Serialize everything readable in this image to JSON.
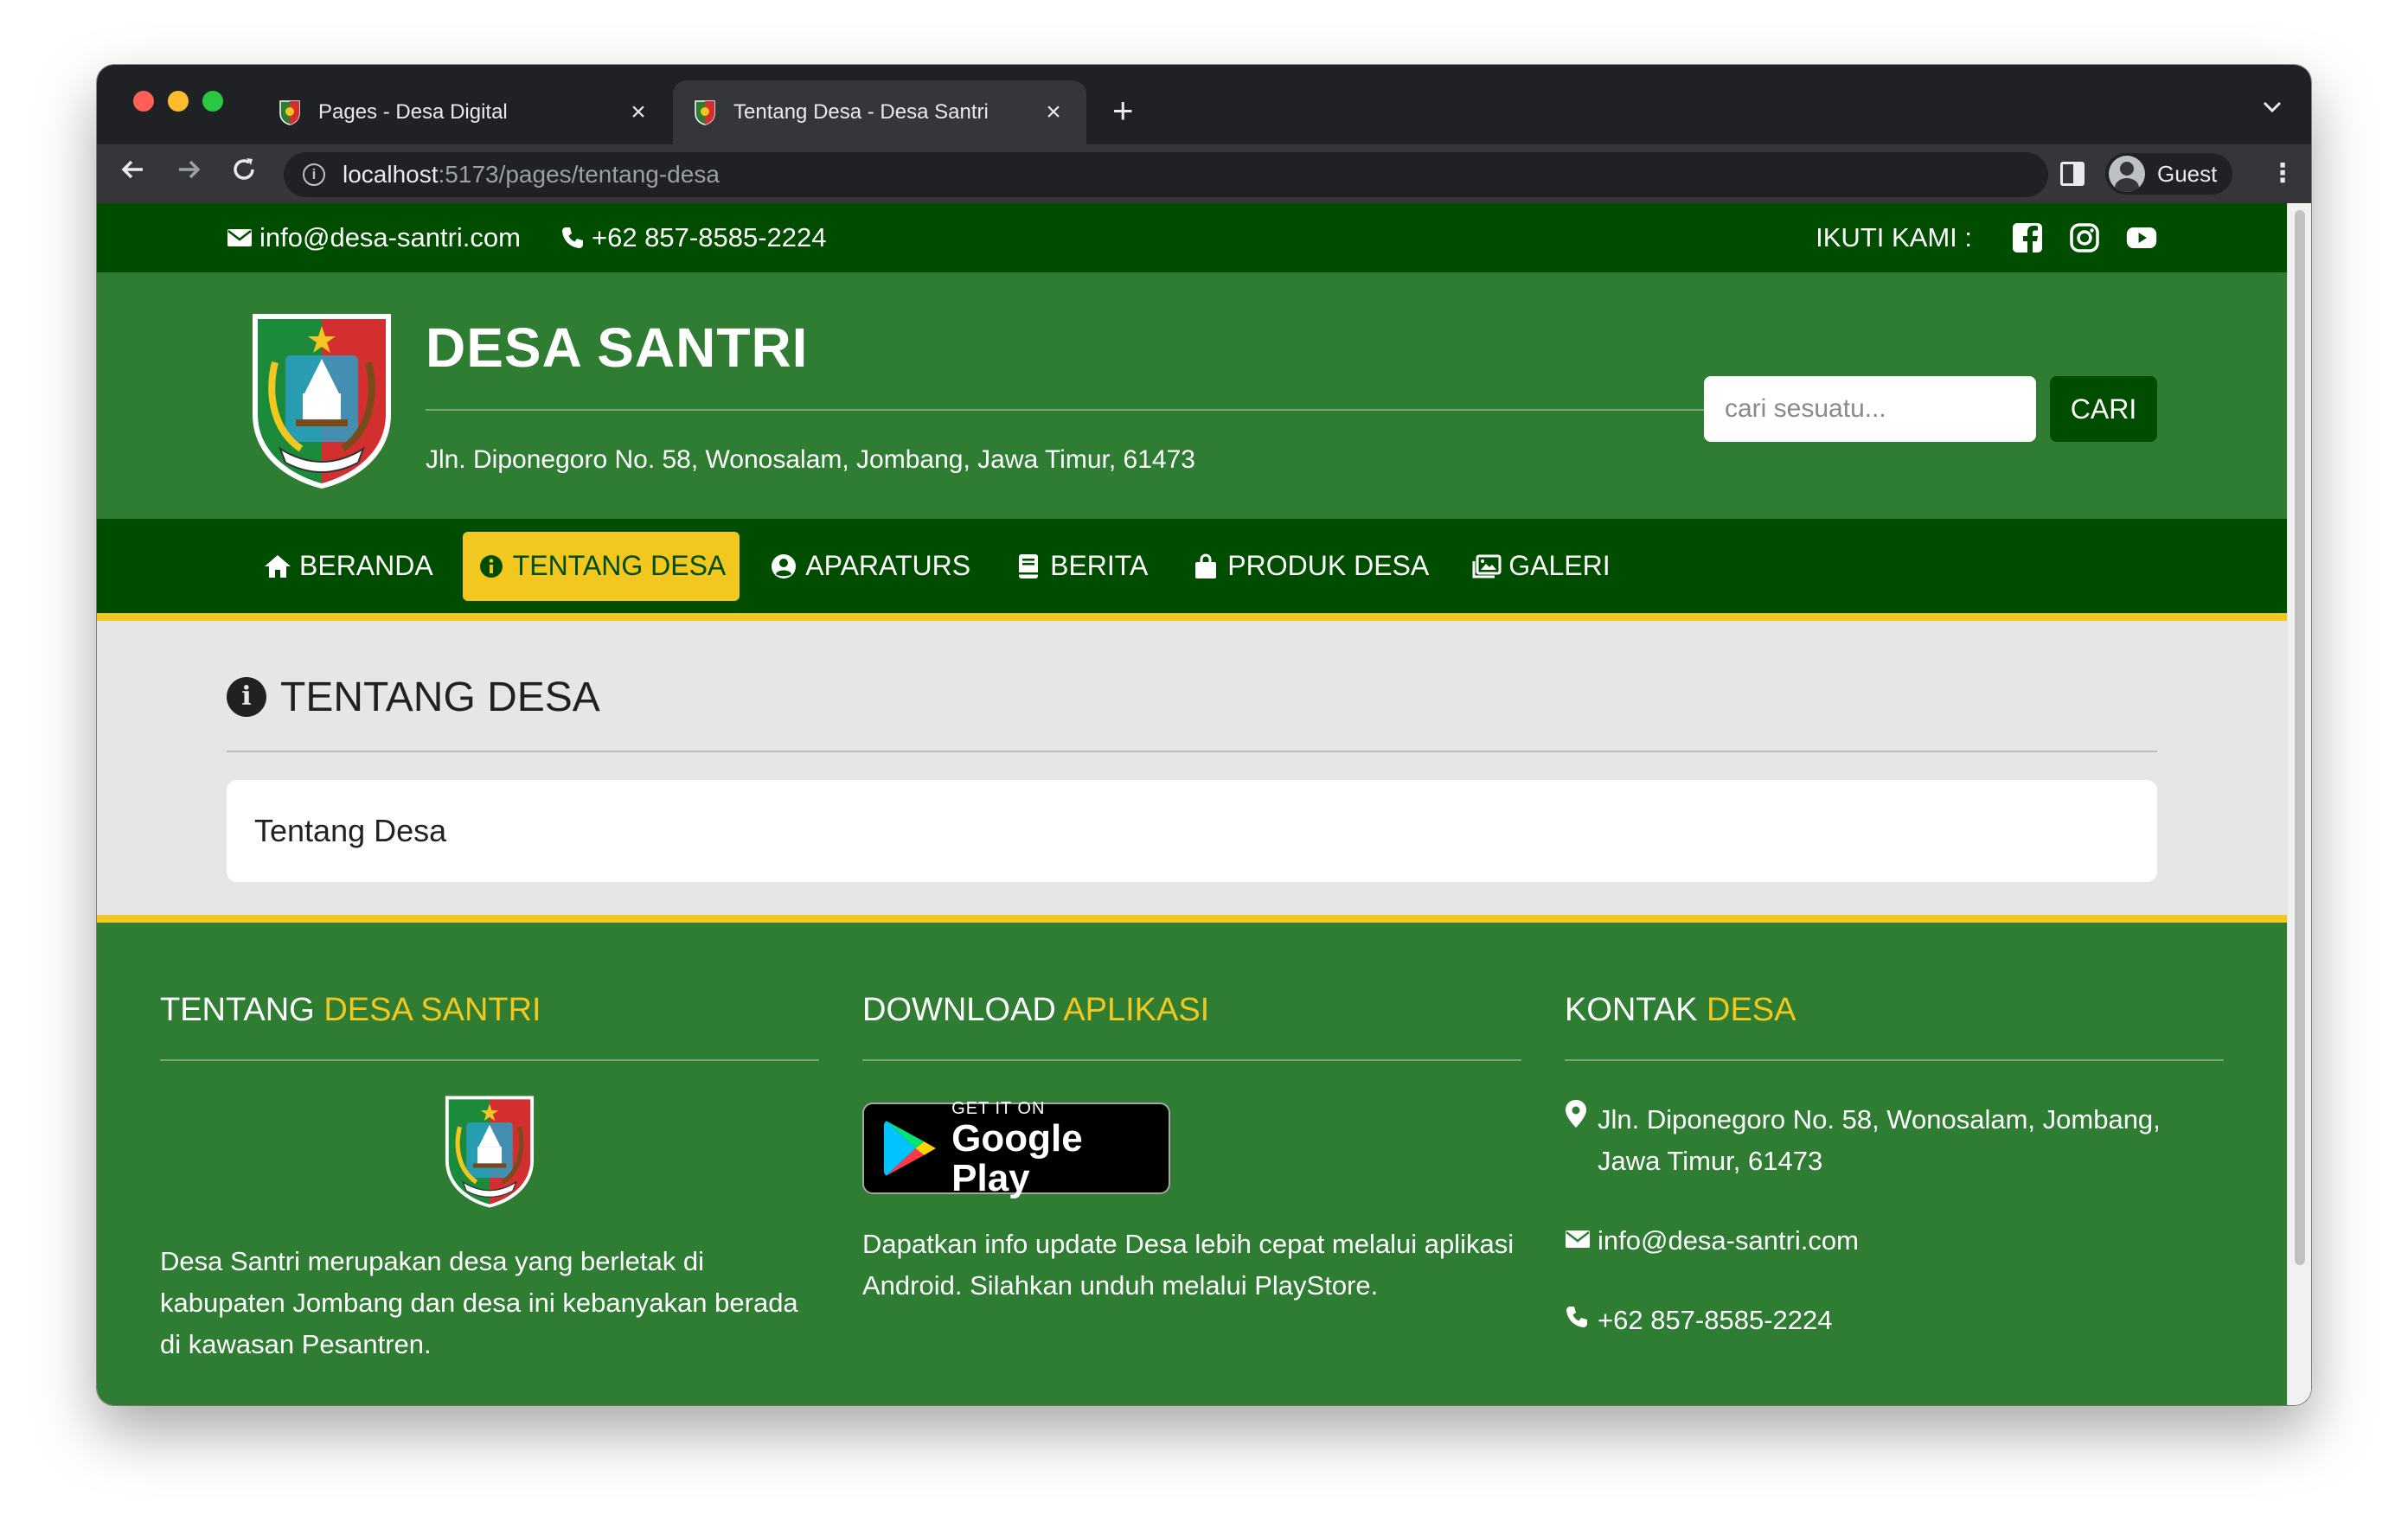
{
  "browser": {
    "tabs": [
      {
        "title": "Pages - Desa Digital",
        "active": false
      },
      {
        "title": "Tentang Desa - Desa Santri",
        "active": true
      }
    ],
    "url_host": "localhost",
    "url_path": ":5173/pages/tentang-desa",
    "profile_label": "Guest"
  },
  "topbar": {
    "email": "info@desa-santri.com",
    "phone": "+62 857-8585-2224",
    "follow_label": "IKUTI KAMI :",
    "social_icons": [
      "facebook-icon",
      "instagram-icon",
      "youtube-icon"
    ]
  },
  "header": {
    "title": "DESA SANTRI",
    "address": "Jln. Diponegoro No. 58, Wonosalam, Jombang, Jawa Timur, 61473",
    "search_placeholder": "cari sesuatu...",
    "search_button": "CARI"
  },
  "nav": {
    "items": [
      {
        "label": "BERANDA",
        "icon": "home-icon",
        "active": false
      },
      {
        "label": "TENTANG DESA",
        "icon": "info-icon",
        "active": true
      },
      {
        "label": "APARATURS",
        "icon": "user-circle-icon",
        "active": false
      },
      {
        "label": "BERITA",
        "icon": "book-icon",
        "active": false
      },
      {
        "label": "PRODUK DESA",
        "icon": "shopping-bag-icon",
        "active": false
      },
      {
        "label": "GALERI",
        "icon": "images-icon",
        "active": false
      }
    ]
  },
  "content": {
    "heading": "TENTANG DESA",
    "body": "Tentang Desa"
  },
  "footer": {
    "about": {
      "title_plain": "TENTANG",
      "title_highlight": "DESA SANTRI",
      "text": "Desa Santri merupakan desa yang berletak di kabupaten Jombang dan desa ini kebanyakan berada di kawasan Pesantren."
    },
    "download": {
      "title_plain": "DOWNLOAD",
      "title_highlight": "APLIKASI",
      "badge_small": "GET IT ON",
      "badge_big": "Google Play",
      "text": "Dapatkan info update Desa lebih cepat melalui aplikasi Android. Silahkan unduh melalui PlayStore."
    },
    "contact": {
      "title_plain": "KONTAK",
      "title_highlight": "DESA",
      "address": "Jln. Diponegoro No. 58, Wonosalam, Jombang, Jawa Timur, 61473",
      "email": "info@desa-santri.com",
      "phone": "+62 857-8585-2224"
    }
  },
  "colors": {
    "dark_green": "#004d00",
    "green": "#2e7d32",
    "yellow": "#f2c820"
  }
}
